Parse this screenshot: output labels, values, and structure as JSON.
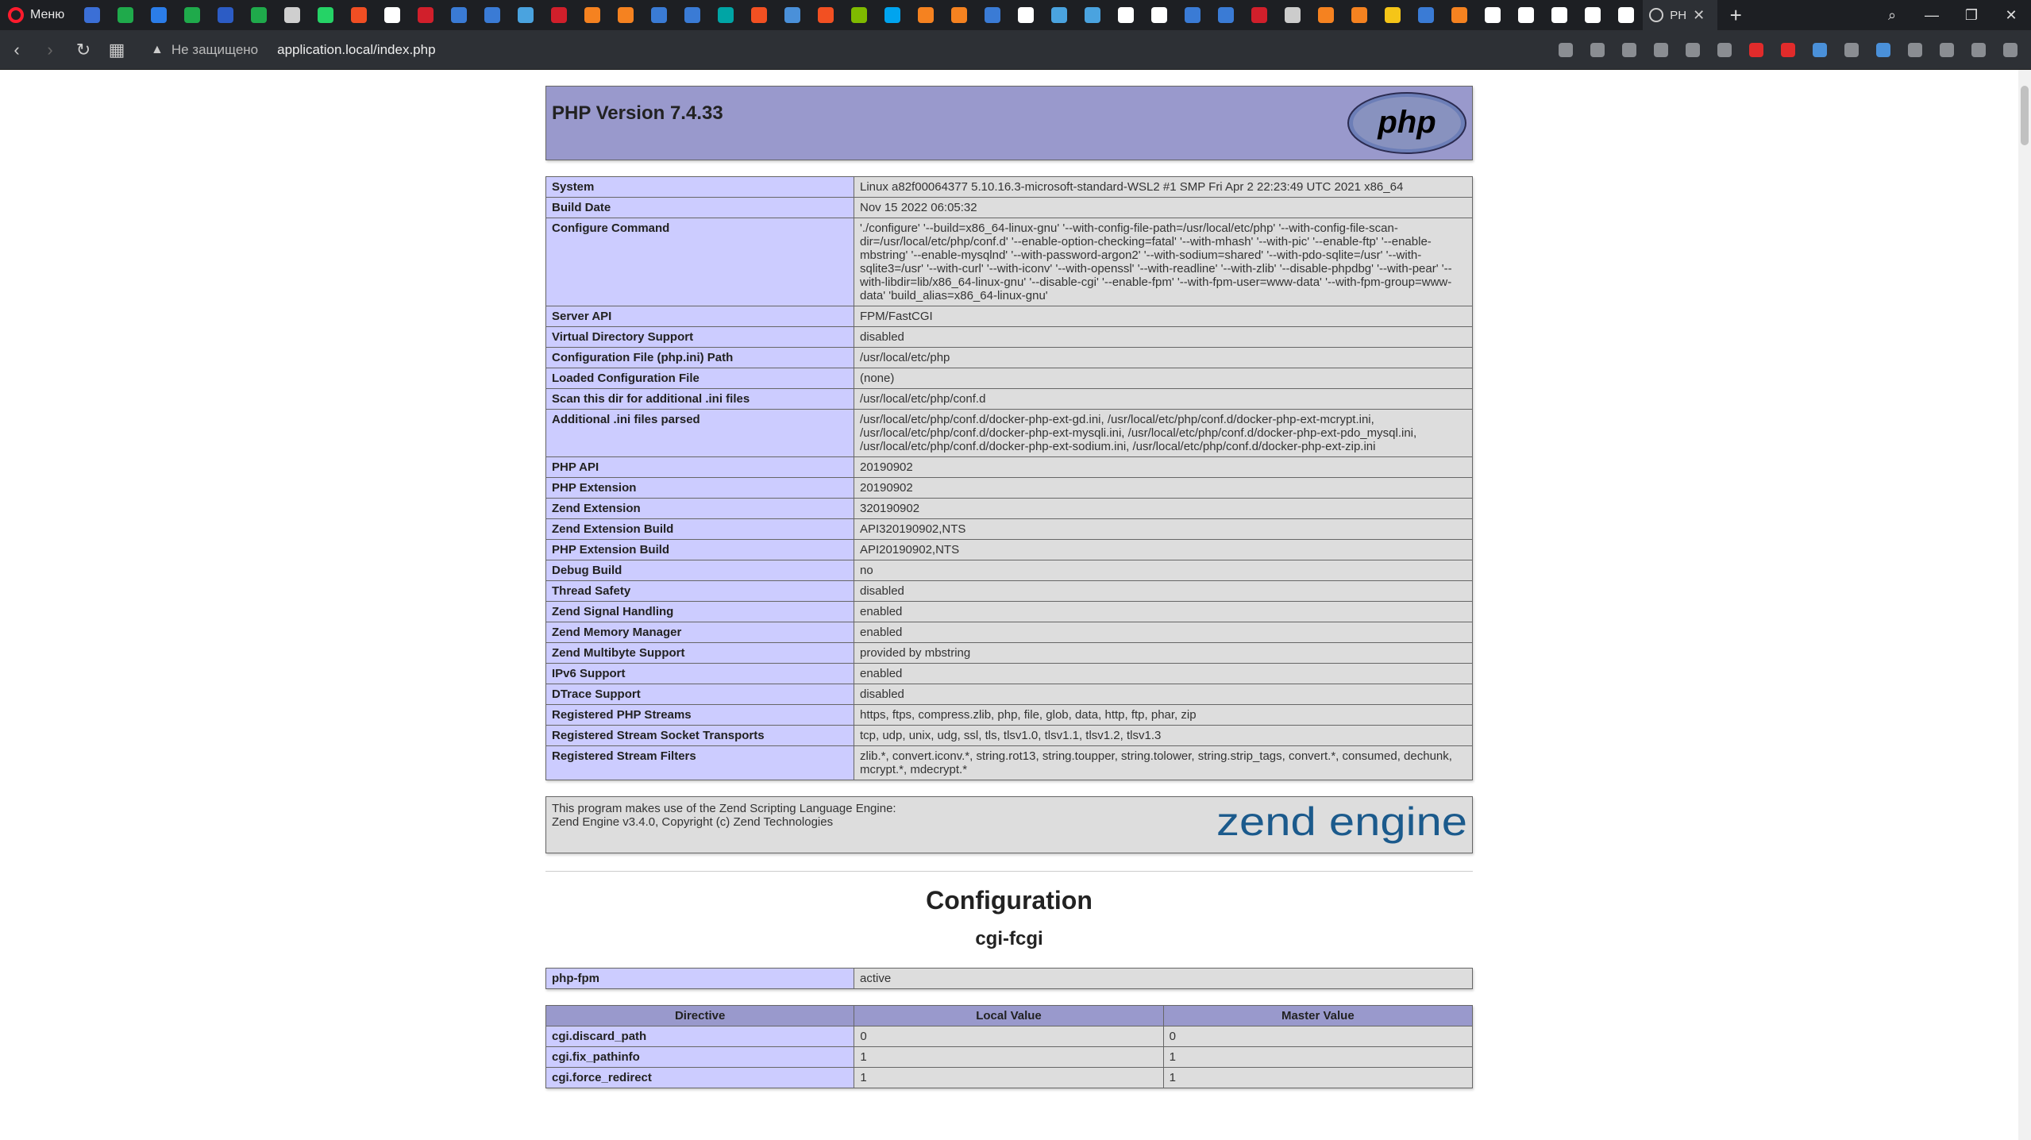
{
  "browser": {
    "menu_label": "Меню",
    "active_tab_title": "PH",
    "not_secure": "Не защищено",
    "url": "application.local/index.php",
    "tab_icon_colors": [
      "#3b6fd6",
      "#1faa4b",
      "#2b7de9",
      "#1faa4b",
      "#2c5cc5",
      "#1faa4b",
      "#cfcfcf",
      "#25d366",
      "#f04e23",
      "#ffffff",
      "#d11f2b",
      "#3a7bd5",
      "#3a7bd5",
      "#4aa3df",
      "#d11f2b",
      "#f58220",
      "#f58220",
      "#3a7bd5",
      "#3a7bd5",
      "#00a5a5",
      "#f25022",
      "#4a90d9",
      "#f25022",
      "#7fba00",
      "#00a4ef",
      "#f58220",
      "#f58220",
      "#3a7bd5",
      "#ffffff",
      "#4aa3df",
      "#4aa3df",
      "#ffffff",
      "#ffffff",
      "#3a7bd5",
      "#3a7bd5",
      "#d11f2b",
      "#cccccc",
      "#f58220",
      "#f58220",
      "#f5c518",
      "#3a7bd5",
      "#f58220",
      "#ffffff",
      "#ffffff",
      "#ffffff",
      "#ffffff",
      "#ffffff"
    ],
    "ext_icon_colors": [
      "#8a8d92",
      "#8a8d92",
      "#8a8d92",
      "#8a8d92",
      "#8a8d92",
      "#8a8d92",
      "#e12b2b",
      "#e12b2b",
      "#4a90d9",
      "#8a8d92",
      "#4a90d9",
      "#8a8d92",
      "#8a8d92",
      "#8a8d92",
      "#8a8d92"
    ]
  },
  "php": {
    "version_title": "PHP Version 7.4.33",
    "logo_text": "php",
    "info_rows": [
      {
        "k": "System",
        "v": "Linux a82f00064377 5.10.16.3-microsoft-standard-WSL2 #1 SMP Fri Apr 2 22:23:49 UTC 2021 x86_64"
      },
      {
        "k": "Build Date",
        "v": "Nov 15 2022 06:05:32"
      },
      {
        "k": "Configure Command",
        "v": "'./configure' '--build=x86_64-linux-gnu' '--with-config-file-path=/usr/local/etc/php' '--with-config-file-scan-dir=/usr/local/etc/php/conf.d' '--enable-option-checking=fatal' '--with-mhash' '--with-pic' '--enable-ftp' '--enable-mbstring' '--enable-mysqlnd' '--with-password-argon2' '--with-sodium=shared' '--with-pdo-sqlite=/usr' '--with-sqlite3=/usr' '--with-curl' '--with-iconv' '--with-openssl' '--with-readline' '--with-zlib' '--disable-phpdbg' '--with-pear' '--with-libdir=lib/x86_64-linux-gnu' '--disable-cgi' '--enable-fpm' '--with-fpm-user=www-data' '--with-fpm-group=www-data' 'build_alias=x86_64-linux-gnu'"
      },
      {
        "k": "Server API",
        "v": "FPM/FastCGI"
      },
      {
        "k": "Virtual Directory Support",
        "v": "disabled"
      },
      {
        "k": "Configuration File (php.ini) Path",
        "v": "/usr/local/etc/php"
      },
      {
        "k": "Loaded Configuration File",
        "v": "(none)"
      },
      {
        "k": "Scan this dir for additional .ini files",
        "v": "/usr/local/etc/php/conf.d"
      },
      {
        "k": "Additional .ini files parsed",
        "v": "/usr/local/etc/php/conf.d/docker-php-ext-gd.ini, /usr/local/etc/php/conf.d/docker-php-ext-mcrypt.ini, /usr/local/etc/php/conf.d/docker-php-ext-mysqli.ini, /usr/local/etc/php/conf.d/docker-php-ext-pdo_mysql.ini, /usr/local/etc/php/conf.d/docker-php-ext-sodium.ini, /usr/local/etc/php/conf.d/docker-php-ext-zip.ini"
      },
      {
        "k": "PHP API",
        "v": "20190902"
      },
      {
        "k": "PHP Extension",
        "v": "20190902"
      },
      {
        "k": "Zend Extension",
        "v": "320190902"
      },
      {
        "k": "Zend Extension Build",
        "v": "API320190902,NTS"
      },
      {
        "k": "PHP Extension Build",
        "v": "API20190902,NTS"
      },
      {
        "k": "Debug Build",
        "v": "no"
      },
      {
        "k": "Thread Safety",
        "v": "disabled"
      },
      {
        "k": "Zend Signal Handling",
        "v": "enabled"
      },
      {
        "k": "Zend Memory Manager",
        "v": "enabled"
      },
      {
        "k": "Zend Multibyte Support",
        "v": "provided by mbstring"
      },
      {
        "k": "IPv6 Support",
        "v": "enabled"
      },
      {
        "k": "DTrace Support",
        "v": "disabled"
      },
      {
        "k": "Registered PHP Streams",
        "v": "https, ftps, compress.zlib, php, file, glob, data, http, ftp, phar, zip"
      },
      {
        "k": "Registered Stream Socket Transports",
        "v": "tcp, udp, unix, udg, ssl, tls, tlsv1.0, tlsv1.1, tlsv1.2, tlsv1.3"
      },
      {
        "k": "Registered Stream Filters",
        "v": "zlib.*, convert.iconv.*, string.rot13, string.toupper, string.tolower, string.strip_tags, convert.*, consumed, dechunk, mcrypt.*, mdecrypt.*"
      }
    ],
    "zend_line1": "This program makes use of the Zend Scripting Language Engine:",
    "zend_line2": "Zend Engine v3.4.0, Copyright (c) Zend Technologies",
    "zend_logo_text": "zend engine",
    "config_heading": "Configuration",
    "module_heading": "cgi-fcgi",
    "fcgi_rows": [
      {
        "k": "php-fpm",
        "v": "active"
      }
    ],
    "directive_headers": [
      "Directive",
      "Local Value",
      "Master Value"
    ],
    "directive_rows": [
      {
        "k": "cgi.discard_path",
        "local": "0",
        "master": "0"
      },
      {
        "k": "cgi.fix_pathinfo",
        "local": "1",
        "master": "1"
      },
      {
        "k": "cgi.force_redirect",
        "local": "1",
        "master": "1"
      }
    ]
  }
}
